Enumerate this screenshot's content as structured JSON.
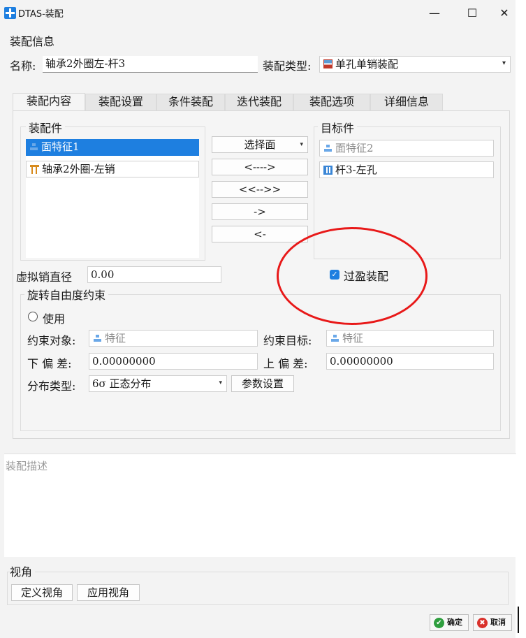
{
  "window": {
    "title": "DTAS-装配",
    "min_glyph": "—",
    "max_glyph": "☐",
    "close_glyph": "✕"
  },
  "info": {
    "group_label": "装配信息",
    "name_label": "名称:",
    "name_value": "轴承2外圈左-杆3",
    "type_label": "装配类型:",
    "type_value": "单孔单销装配"
  },
  "tabs": [
    "装配内容",
    "装配设置",
    "条件装配",
    "迭代装配",
    "装配选项",
    "详细信息"
  ],
  "content": {
    "parts_label": "装配件",
    "parts": [
      "面特征1",
      "轴承2外圈-左销"
    ],
    "target_label": "目标件",
    "targets": [
      "面特征2",
      "杆3-左孔"
    ],
    "select_face": "选择面",
    "ops": [
      "<---->",
      "<<-->>",
      "->",
      "<-"
    ],
    "virtual_pin_label": "虚拟销直径",
    "virtual_pin_value": "0.00",
    "interference_label": "过盈装配",
    "interference_checked": true
  },
  "rotation": {
    "group_label": "旋转自由度约束",
    "use_label": "使用",
    "obj_label": "约束对象:",
    "obj_value": "特征",
    "target_label": "约束目标:",
    "target_value": "特征",
    "lower_label": "下 偏 差:",
    "lower_value": "0.00000000",
    "upper_label": "上 偏 差:",
    "upper_value": "0.00000000",
    "dist_label": "分布类型:",
    "dist_value": "6σ 正态分布",
    "param_btn": "参数设置"
  },
  "description": {
    "placeholder": "装配描述"
  },
  "view": {
    "group_label": "视角",
    "define": "定义视角",
    "apply": "应用视角"
  },
  "footer": {
    "ok": "确定",
    "cancel": "取消",
    "ok_glyph": "✔",
    "cancel_glyph": "✖"
  },
  "colors": {
    "accent": "#1e7fe0",
    "annotation": "#e81919",
    "ok": "#2e9e3e",
    "cancel": "#d9312b"
  }
}
